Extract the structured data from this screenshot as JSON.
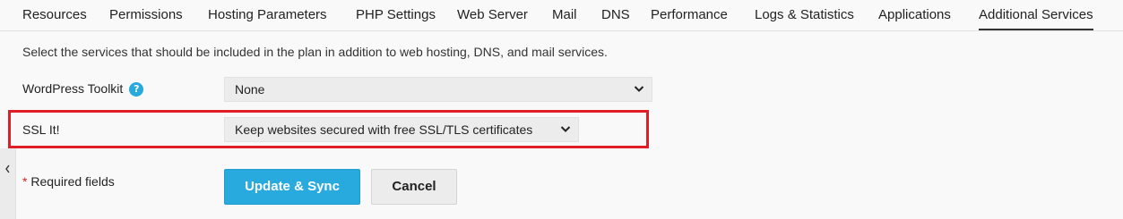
{
  "tabs": [
    {
      "label": "Resources"
    },
    {
      "label": "Permissions"
    },
    {
      "label": "Hosting Parameters"
    },
    {
      "label": "PHP Settings"
    },
    {
      "label": "Web Server"
    },
    {
      "label": "Mail"
    },
    {
      "label": "DNS"
    },
    {
      "label": "Performance"
    },
    {
      "label": "Logs & Statistics"
    },
    {
      "label": "Applications"
    },
    {
      "label": "Additional Services",
      "active": true
    }
  ],
  "intro": "Select the services that should be included in the plan in addition to web hosting, DNS, and mail services.",
  "fields": {
    "wordpress_toolkit": {
      "label": "WordPress Toolkit",
      "help_icon": "question-mark-icon",
      "value": "None"
    },
    "ssl_it": {
      "label": "SSL It!",
      "value": "Keep websites secured with free SSL/TLS certificates"
    }
  },
  "required_note": {
    "star": "*",
    "text": "Required fields"
  },
  "buttons": {
    "update_sync": "Update & Sync",
    "cancel": "Cancel"
  },
  "colors": {
    "accent": "#28aade",
    "highlight": "#e01e26",
    "required_star": "#e01e26"
  }
}
